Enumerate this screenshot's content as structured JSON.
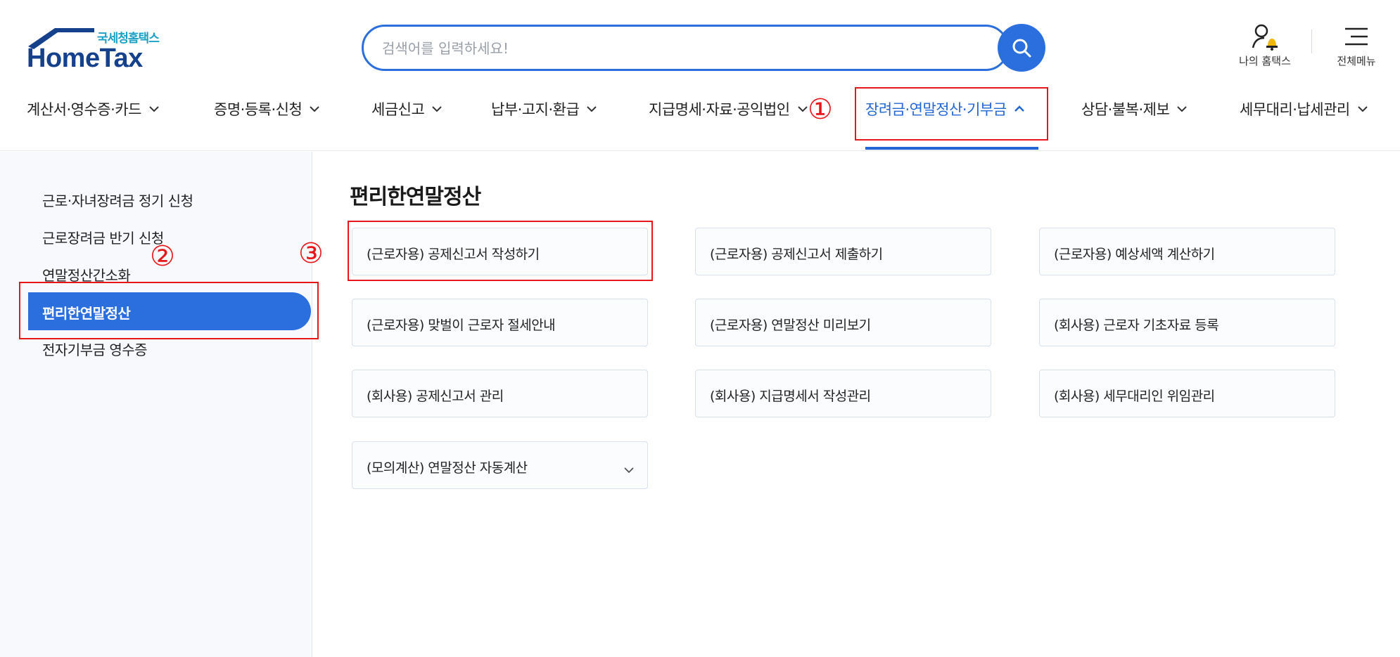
{
  "header": {
    "logo": {
      "sub": "국세청홈택스",
      "main": "HomeTax"
    },
    "search": {
      "placeholder": "검색어를 입력하세요!",
      "value": ""
    },
    "utilities": {
      "my_hometax": "나의 홈택스",
      "all_menu": "전체메뉴"
    }
  },
  "gnb": {
    "items": [
      {
        "label": "계산서·영수증·카드",
        "chevron": "down"
      },
      {
        "label": "증명·등록·신청",
        "chevron": "down"
      },
      {
        "label": "세금신고",
        "chevron": "down"
      },
      {
        "label": "납부·고지·환급",
        "chevron": "down"
      },
      {
        "label": "지급명세·자료·공익법인",
        "chevron": "down"
      },
      {
        "label": "장려금·연말정산·기부금",
        "chevron": "up",
        "active": true
      },
      {
        "label": "상담·불복·제보",
        "chevron": "down"
      },
      {
        "label": "세무대리·납세관리",
        "chevron": "down"
      }
    ]
  },
  "sidebar": {
    "items": [
      {
        "label": "근로·자녀장려금 정기 신청"
      },
      {
        "label": "근로장려금 반기 신청"
      },
      {
        "label": "연말정산간소화"
      },
      {
        "label": "편리한연말정산",
        "active": true
      },
      {
        "label": "전자기부금 영수증"
      }
    ]
  },
  "main": {
    "title": "편리한연말정산",
    "cards": [
      {
        "label": "(근로자용) 공제신고서 작성하기"
      },
      {
        "label": "(근로자용) 공제신고서 제출하기"
      },
      {
        "label": "(근로자용) 예상세액 계산하기"
      },
      {
        "label": "(근로자용) 맞벌이 근로자 절세안내"
      },
      {
        "label": "(근로자용) 연말정산 미리보기"
      },
      {
        "label": "(회사용) 근로자 기초자료 등록"
      },
      {
        "label": "(회사용) 공제신고서 관리"
      },
      {
        "label": "(회사용) 지급명세서 작성관리"
      },
      {
        "label": "(회사용) 세무대리인 위임관리"
      },
      {
        "label": "(모의계산) 연말정산 자동계산",
        "expandable": true
      }
    ]
  },
  "annotations": {
    "step1": "①",
    "step2": "②",
    "step3": "③"
  },
  "colors": {
    "accent": "#2b6fde",
    "annotation": "#e8151b",
    "logo_navy": "#14408c",
    "logo_teal": "#1aa0c4"
  },
  "icons": [
    "search-icon",
    "user-bell-icon",
    "hamburger-menu-icon",
    "chevron-down-icon",
    "chevron-up-icon"
  ]
}
